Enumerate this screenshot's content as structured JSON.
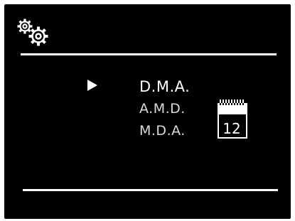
{
  "screen": {
    "header_icon": "settings-gears-icon",
    "menu": {
      "items": [
        {
          "label": "D.M.A.",
          "selected": true
        },
        {
          "label": "A.M.D.",
          "selected": false
        },
        {
          "label": "M.D.A.",
          "selected": false
        }
      ],
      "cursor_icon": "right-triangle-cursor-icon"
    },
    "calendar": {
      "icon": "calendar-icon",
      "day": "12"
    }
  },
  "colors": {
    "background": "#000000",
    "foreground": "#ffffff",
    "text_dim": "#d9d9d9"
  }
}
